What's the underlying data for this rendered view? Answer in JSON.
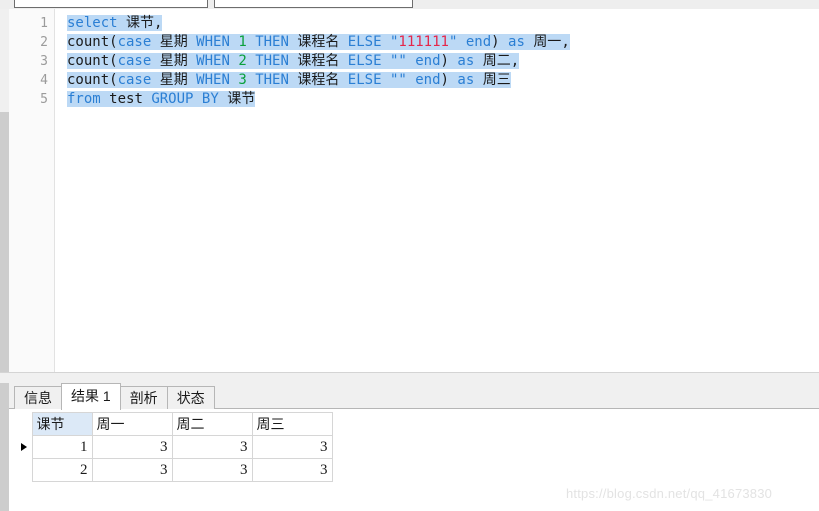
{
  "toolbar": {
    "box1_label": "",
    "box2_label": ""
  },
  "editor": {
    "line_numbers": [
      "1",
      "2",
      "3",
      "4",
      "5"
    ],
    "lines": [
      {
        "n": "1",
        "tokens": [
          {
            "t": "select",
            "c": "kw"
          },
          {
            "t": " ",
            "c": "pl"
          },
          {
            "t": "课节",
            "c": "cn"
          },
          {
            "t": ",",
            "c": "pl"
          }
        ]
      },
      {
        "n": "2",
        "tokens": [
          {
            "t": "count(",
            "c": "pl"
          },
          {
            "t": "case",
            "c": "kw"
          },
          {
            "t": " ",
            "c": "pl"
          },
          {
            "t": "星期",
            "c": "cn"
          },
          {
            "t": " ",
            "c": "pl"
          },
          {
            "t": "WHEN",
            "c": "kw"
          },
          {
            "t": " ",
            "c": "pl"
          },
          {
            "t": "1",
            "c": "num"
          },
          {
            "t": " ",
            "c": "pl"
          },
          {
            "t": "THEN",
            "c": "kw"
          },
          {
            "t": " ",
            "c": "pl"
          },
          {
            "t": "课程名",
            "c": "cn"
          },
          {
            "t": " ",
            "c": "pl"
          },
          {
            "t": "ELSE",
            "c": "kw"
          },
          {
            "t": " ",
            "c": "pl"
          },
          {
            "t": "\"",
            "c": "qt"
          },
          {
            "t": "111111",
            "c": "str"
          },
          {
            "t": "\"",
            "c": "qt"
          },
          {
            "t": " ",
            "c": "pl"
          },
          {
            "t": "end",
            "c": "kw"
          },
          {
            "t": ")",
            "c": "pl"
          },
          {
            "t": " ",
            "c": "pl"
          },
          {
            "t": "as",
            "c": "kw"
          },
          {
            "t": " ",
            "c": "pl"
          },
          {
            "t": "周一",
            "c": "cn"
          },
          {
            "t": ",",
            "c": "pl"
          }
        ]
      },
      {
        "n": "3",
        "tokens": [
          {
            "t": "count(",
            "c": "pl"
          },
          {
            "t": "case",
            "c": "kw"
          },
          {
            "t": " ",
            "c": "pl"
          },
          {
            "t": "星期",
            "c": "cn"
          },
          {
            "t": " ",
            "c": "pl"
          },
          {
            "t": "WHEN",
            "c": "kw"
          },
          {
            "t": " ",
            "c": "pl"
          },
          {
            "t": "2",
            "c": "num"
          },
          {
            "t": " ",
            "c": "pl"
          },
          {
            "t": "THEN",
            "c": "kw"
          },
          {
            "t": " ",
            "c": "pl"
          },
          {
            "t": "课程名",
            "c": "cn"
          },
          {
            "t": " ",
            "c": "pl"
          },
          {
            "t": "ELSE",
            "c": "kw"
          },
          {
            "t": " ",
            "c": "pl"
          },
          {
            "t": "\"\"",
            "c": "qt"
          },
          {
            "t": " ",
            "c": "pl"
          },
          {
            "t": "end",
            "c": "kw"
          },
          {
            "t": ")",
            "c": "pl"
          },
          {
            "t": " ",
            "c": "pl"
          },
          {
            "t": "as",
            "c": "kw"
          },
          {
            "t": " ",
            "c": "pl"
          },
          {
            "t": "周二",
            "c": "cn"
          },
          {
            "t": ",",
            "c": "pl"
          }
        ]
      },
      {
        "n": "4",
        "tokens": [
          {
            "t": "count(",
            "c": "pl"
          },
          {
            "t": "case",
            "c": "kw"
          },
          {
            "t": " ",
            "c": "pl"
          },
          {
            "t": "星期",
            "c": "cn"
          },
          {
            "t": " ",
            "c": "pl"
          },
          {
            "t": "WHEN",
            "c": "kw"
          },
          {
            "t": " ",
            "c": "pl"
          },
          {
            "t": "3",
            "c": "num"
          },
          {
            "t": " ",
            "c": "pl"
          },
          {
            "t": "THEN",
            "c": "kw"
          },
          {
            "t": " ",
            "c": "pl"
          },
          {
            "t": "课程名",
            "c": "cn"
          },
          {
            "t": " ",
            "c": "pl"
          },
          {
            "t": "ELSE",
            "c": "kw"
          },
          {
            "t": " ",
            "c": "pl"
          },
          {
            "t": "\"\"",
            "c": "qt"
          },
          {
            "t": " ",
            "c": "pl"
          },
          {
            "t": "end",
            "c": "kw"
          },
          {
            "t": ")",
            "c": "pl"
          },
          {
            "t": " ",
            "c": "pl"
          },
          {
            "t": "as",
            "c": "kw"
          },
          {
            "t": " ",
            "c": "pl"
          },
          {
            "t": "周三",
            "c": "cn"
          }
        ]
      },
      {
        "n": "5",
        "tokens": [
          {
            "t": "from",
            "c": "kw"
          },
          {
            "t": " ",
            "c": "pl"
          },
          {
            "t": "test",
            "c": "pl"
          },
          {
            "t": " ",
            "c": "pl"
          },
          {
            "t": "GROUP",
            "c": "kw"
          },
          {
            "t": " ",
            "c": "pl"
          },
          {
            "t": "BY",
            "c": "kw"
          },
          {
            "t": " ",
            "c": "pl"
          },
          {
            "t": "课节",
            "c": "cn"
          }
        ]
      }
    ],
    "selection_color": "#bcd9f5",
    "keyword_color": "#2b7fd4",
    "number_color": "#0aa03c",
    "string_color": "#e5264a"
  },
  "results": {
    "tabs": [
      {
        "label": "信息",
        "active": false
      },
      {
        "label": "结果 1",
        "active": true
      },
      {
        "label": "剖析",
        "active": false
      },
      {
        "label": "状态",
        "active": false
      }
    ],
    "grid": {
      "columns": [
        "课节",
        "周一",
        "周二",
        "周三"
      ],
      "selected_column": "课节",
      "rows": [
        {
          "current": true,
          "cells": [
            "1",
            "3",
            "3",
            "3"
          ]
        },
        {
          "current": false,
          "cells": [
            "2",
            "3",
            "3",
            "3"
          ]
        }
      ]
    }
  },
  "watermark": {
    "text": "https://blog.csdn.net/qq_41673830"
  }
}
